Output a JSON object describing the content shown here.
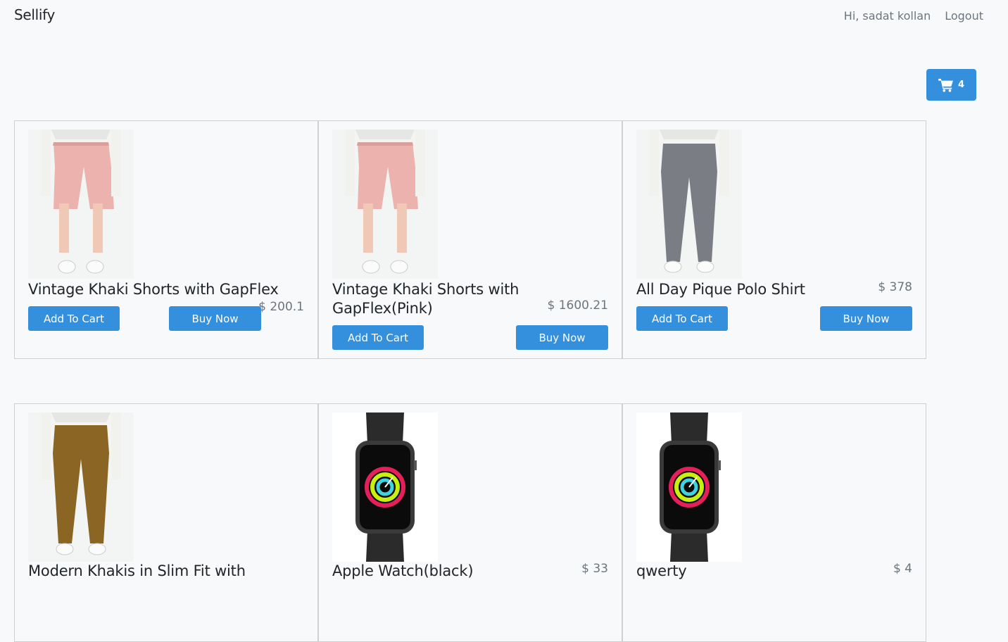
{
  "nav": {
    "brand": "Sellify",
    "greeting": "Hi, sadat kollan",
    "logout": "Logout"
  },
  "cart": {
    "count": "4",
    "icon": "cart-icon"
  },
  "colors": {
    "primary": "#3490dc",
    "background": "#f8f9fa"
  },
  "products": [
    {
      "name": "Vintage Khaki Shorts with GapFlex",
      "price": "$ 200.1",
      "add": "Add To Cart",
      "buy": "Buy Now",
      "image": "pink-shorts"
    },
    {
      "name": "Vintage Khaki Shorts with GapFlex(Pink)",
      "price": "$ 1600.21",
      "add": "Add To Cart",
      "buy": "Buy Now",
      "image": "pink-shorts"
    },
    {
      "name": "All Day Pique Polo Shirt",
      "price": "$ 378",
      "add": "Add To Cart",
      "buy": "Buy Now",
      "image": "gray-pants"
    },
    {
      "name": "Modern Khakis in Slim Fit with",
      "price": "",
      "image": "brown-pants"
    },
    {
      "name": "Apple Watch(black)",
      "price": "$ 33",
      "image": "apple-watch"
    },
    {
      "name": "qwerty",
      "price": "$ 4",
      "image": "apple-watch"
    }
  ]
}
